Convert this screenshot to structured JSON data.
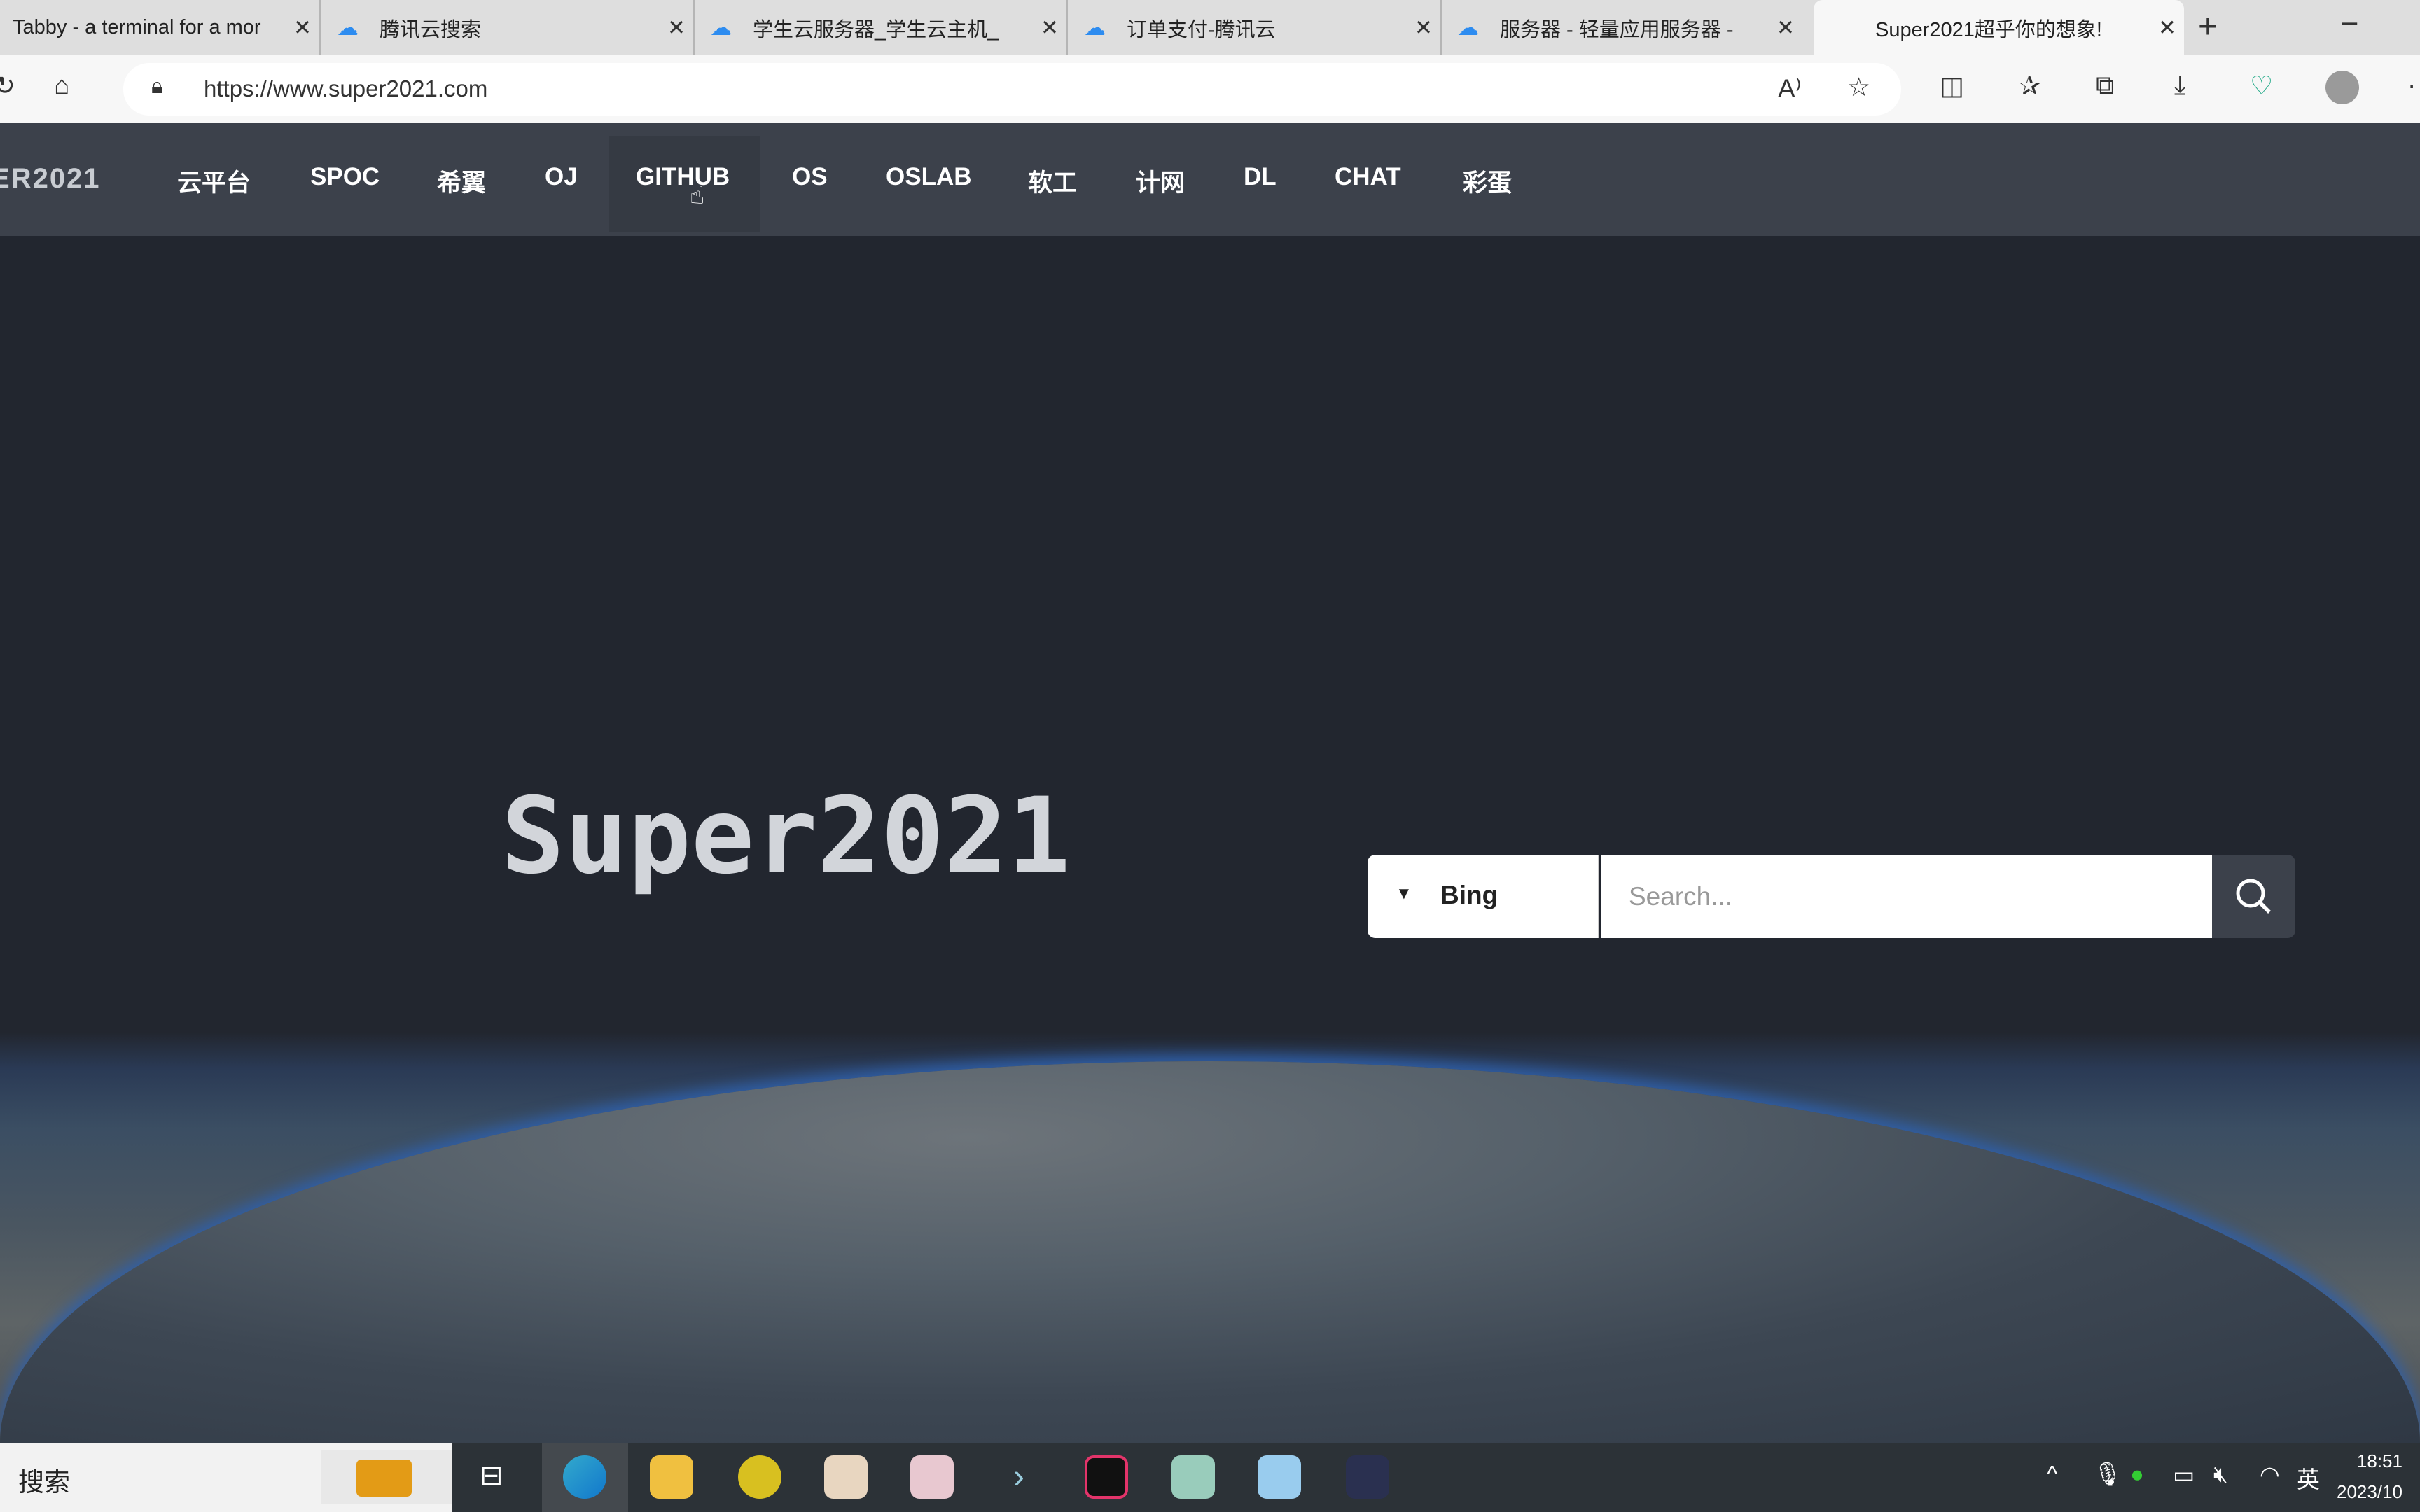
{
  "browser": {
    "tabs": [
      {
        "label": "Tabby - a terminal for a mor",
        "icon": "none"
      },
      {
        "label": "腾讯云搜索",
        "icon": "tencent-cloud-icon"
      },
      {
        "label": "学生云服务器_学生云主机_",
        "icon": "tencent-cloud-icon"
      },
      {
        "label": "订单支付-腾讯云",
        "icon": "tencent-cloud-icon"
      },
      {
        "label": "服务器 - 轻量应用服务器 -",
        "icon": "tencent-cloud-icon"
      },
      {
        "label": "Super2021超乎你的想象!",
        "icon": "none",
        "active": true
      }
    ],
    "url": "https://www.super2021.com"
  },
  "site": {
    "brand": "ER2021",
    "nav": [
      "云平台",
      "SPOC",
      "希翼",
      "OJ",
      "GITHUB",
      "OS",
      "OSLAB",
      "软工",
      "计网",
      "DL",
      "CHAT",
      "彩蛋"
    ],
    "hovered_nav": "GITHUB",
    "title": "Super2021",
    "search": {
      "engine": "Bing",
      "placeholder": "Search..."
    }
  },
  "taskbar": {
    "search_label": "搜索",
    "ime": "英",
    "time": "18:51",
    "date": "2023/10"
  }
}
